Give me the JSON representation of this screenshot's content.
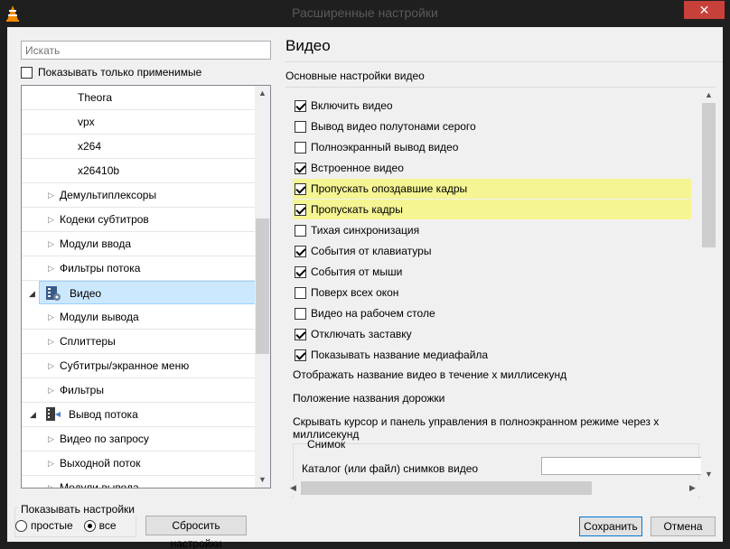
{
  "window": {
    "title": "Расширенные настройки",
    "close": "✕"
  },
  "left": {
    "search_placeholder": "Искать",
    "only_applicable": "Показывать только применимые",
    "tree": [
      {
        "label": "Theora",
        "level": "sub"
      },
      {
        "label": "vpx",
        "level": "sub"
      },
      {
        "label": "x264",
        "level": "sub"
      },
      {
        "label": "x26410b",
        "level": "sub"
      },
      {
        "label": "Демультиплексоры",
        "level": "node"
      },
      {
        "label": "Кодеки субтитров",
        "level": "node"
      },
      {
        "label": "Модули ввода",
        "level": "node"
      },
      {
        "label": "Фильтры потока",
        "level": "node"
      },
      {
        "label": "Видео",
        "level": "category",
        "selected": true
      },
      {
        "label": "Модули вывода",
        "level": "node"
      },
      {
        "label": "Сплиттеры",
        "level": "node"
      },
      {
        "label": "Субтитры/экранное меню",
        "level": "node"
      },
      {
        "label": "Фильтры",
        "level": "node"
      },
      {
        "label": "Вывод потока",
        "level": "category"
      },
      {
        "label": "Видео по запросу",
        "level": "node"
      },
      {
        "label": "Выходной поток",
        "level": "node"
      },
      {
        "label": "Модули вывода",
        "level": "node"
      }
    ]
  },
  "right": {
    "title": "Видео",
    "subtitle": "Основные настройки видео",
    "options": [
      {
        "label": "Включить видео",
        "checked": true,
        "highlight": false
      },
      {
        "label": "Вывод видео полутонами серого",
        "checked": false,
        "highlight": false
      },
      {
        "label": "Полноэкранный вывод видео",
        "checked": false,
        "highlight": false
      },
      {
        "label": "Встроенное видео",
        "checked": true,
        "highlight": false
      },
      {
        "label": "Пропускать опоздавшие кадры",
        "checked": true,
        "highlight": true
      },
      {
        "label": "Пропускать кадры",
        "checked": true,
        "highlight": true
      },
      {
        "label": "Тихая синхронизация",
        "checked": false,
        "highlight": false
      },
      {
        "label": "События от клавиатуры",
        "checked": true,
        "highlight": false
      },
      {
        "label": "События от мыши",
        "checked": true,
        "highlight": false
      },
      {
        "label": "Поверх всех окон",
        "checked": false,
        "highlight": false
      },
      {
        "label": "Видео на рабочем столе",
        "checked": false,
        "highlight": false
      },
      {
        "label": "Отключать заставку",
        "checked": true,
        "highlight": false
      },
      {
        "label": "Показывать название медиафайла",
        "checked": true,
        "highlight": false
      }
    ],
    "text_options": [
      "Отображать название видео в течение x миллисекунд",
      "Положение названия дорожки",
      "Скрывать курсор и панель управления в полноэкранном режиме через x миллисекунд"
    ],
    "snapshot_group": "Снимок",
    "snapshot_dir_label": "Каталог (или файл) снимков видео",
    "snapshot_dir_value": ""
  },
  "bottom": {
    "show_settings": "Показывать настройки",
    "simple": "простые",
    "all": "все",
    "selected": "all",
    "reset": "Сбросить настройки",
    "save": "Сохранить",
    "cancel": "Отмена"
  },
  "colors": {
    "highlight": "#f5f594",
    "selection": "#cce8ff",
    "close": "#c7403a"
  }
}
